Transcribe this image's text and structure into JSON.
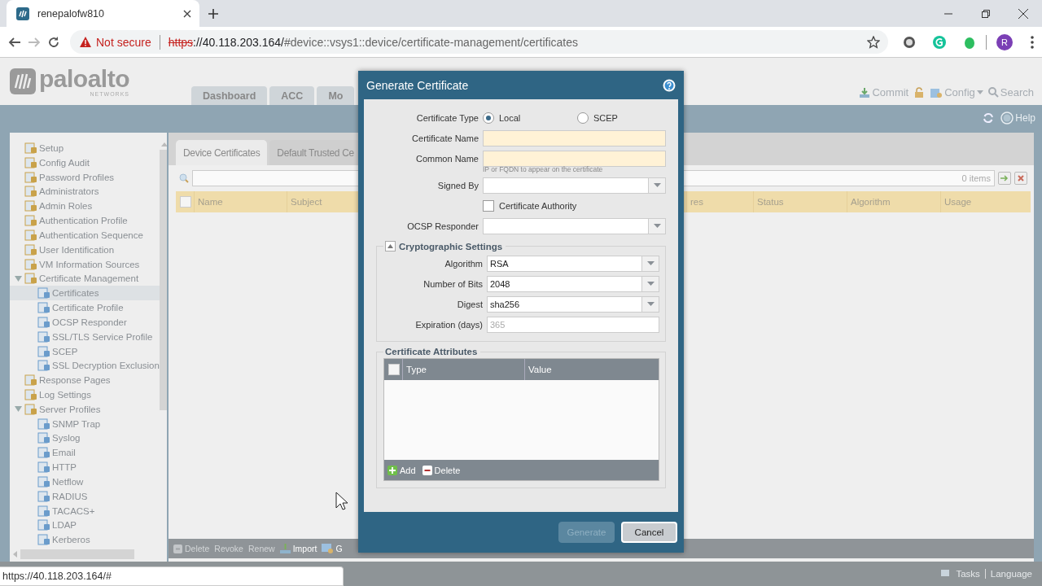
{
  "browser": {
    "tab": {
      "title": "renepalofw810",
      "selected": true
    },
    "security": "Not secure",
    "url": {
      "scheme": "https",
      "rest": "://40.118.203.164/",
      "path": "#device::vsys1::device/certificate-management/certificates"
    },
    "avatar": "R",
    "status_url": "https://40.118.203.164/#"
  },
  "app": {
    "logo": {
      "name": "paloalto",
      "sub": "NETWORKS"
    },
    "nav_tabs": [
      {
        "label": "Dashboard",
        "selected": false
      },
      {
        "label": "ACC",
        "selected": false
      },
      {
        "label": "Mo",
        "selected": false
      }
    ],
    "header_actions": [
      "Commit",
      "Config",
      "Search"
    ],
    "help": "Help",
    "sidebar": [
      {
        "label": "Setup",
        "selected": false
      },
      {
        "label": "Config Audit",
        "selected": false
      },
      {
        "label": "Password Profiles",
        "selected": false
      },
      {
        "label": "Administrators",
        "selected": false
      },
      {
        "label": "Admin Roles",
        "selected": false
      },
      {
        "label": "Authentication Profile",
        "selected": false
      },
      {
        "label": "Authentication Sequence",
        "selected": false
      },
      {
        "label": "User Identification",
        "selected": false
      },
      {
        "label": "VM Information Sources",
        "selected": false
      },
      {
        "label": "Certificate Management",
        "selected": false,
        "expanded": true,
        "children": [
          {
            "label": "Certificates",
            "selected": true
          },
          {
            "label": "Certificate Profile",
            "selected": false
          },
          {
            "label": "OCSP Responder",
            "selected": false
          },
          {
            "label": "SSL/TLS Service Profile",
            "selected": false
          },
          {
            "label": "SCEP",
            "selected": false
          },
          {
            "label": "SSL Decryption Exclusion",
            "selected": false
          }
        ]
      },
      {
        "label": "Response Pages",
        "selected": false
      },
      {
        "label": "Log Settings",
        "selected": false
      },
      {
        "label": "Server Profiles",
        "selected": false,
        "expanded": true,
        "children": [
          {
            "label": "SNMP Trap",
            "selected": false
          },
          {
            "label": "Syslog",
            "selected": false
          },
          {
            "label": "Email",
            "selected": false
          },
          {
            "label": "HTTP",
            "selected": false
          },
          {
            "label": "Netflow",
            "selected": false
          },
          {
            "label": "RADIUS",
            "selected": false
          },
          {
            "label": "TACACS+",
            "selected": false
          },
          {
            "label": "LDAP",
            "selected": false
          },
          {
            "label": "Kerberos",
            "selected": false
          }
        ]
      }
    ],
    "content_tabs": [
      {
        "label": "Device Certificates",
        "selected": true
      },
      {
        "label": "Default Trusted Ce",
        "selected": false
      }
    ],
    "item_count": "0 items",
    "table": {
      "select_all_checked": false,
      "columns": [
        "Name",
        "Subject",
        "res",
        "Status",
        "Algorithm",
        "Usage"
      ]
    },
    "actions": [
      {
        "label": "Delete",
        "disabled": true
      },
      {
        "label": "Revoke",
        "disabled": true
      },
      {
        "label": "Renew",
        "disabled": true
      },
      {
        "label": "Import",
        "disabled": false
      },
      {
        "label": "G",
        "disabled": false
      }
    ],
    "footer": [
      "Tasks",
      "Language"
    ]
  },
  "dialog": {
    "title": "Generate Certificate",
    "cert_type": {
      "label": "Certificate Type",
      "options": [
        {
          "label": "Local",
          "selected": true
        },
        {
          "label": "SCEP",
          "selected": false
        }
      ]
    },
    "fields": [
      {
        "kind": "text",
        "label": "Certificate Name",
        "required": true
      },
      {
        "kind": "text",
        "label": "Common Name",
        "required": true,
        "hint": "IP or FQDN to appear on the certificate"
      },
      {
        "kind": "select",
        "label": "Signed By"
      },
      {
        "kind": "checkbox",
        "label": "Certificate Authority",
        "checked": false
      },
      {
        "kind": "select",
        "label": "OCSP Responder"
      }
    ],
    "crypto": {
      "title": "Cryptographic Settings",
      "expanded": true,
      "fields": [
        {
          "kind": "select",
          "label": "Algorithm",
          "value": "RSA"
        },
        {
          "kind": "select",
          "label": "Number of Bits",
          "value": "2048"
        },
        {
          "kind": "select",
          "label": "Digest",
          "value": "sha256"
        },
        {
          "kind": "text",
          "label": "Expiration (days)",
          "required": false,
          "placeholder": "365"
        }
      ]
    },
    "attributes": {
      "title": "Certificate Attributes",
      "select_all_checked": false,
      "columns": [
        "Type",
        "Value"
      ],
      "actions": [
        "Add",
        "Delete"
      ]
    },
    "buttons": [
      {
        "label": "Generate",
        "disabled": true
      },
      {
        "label": "Cancel",
        "disabled": false
      }
    ]
  }
}
